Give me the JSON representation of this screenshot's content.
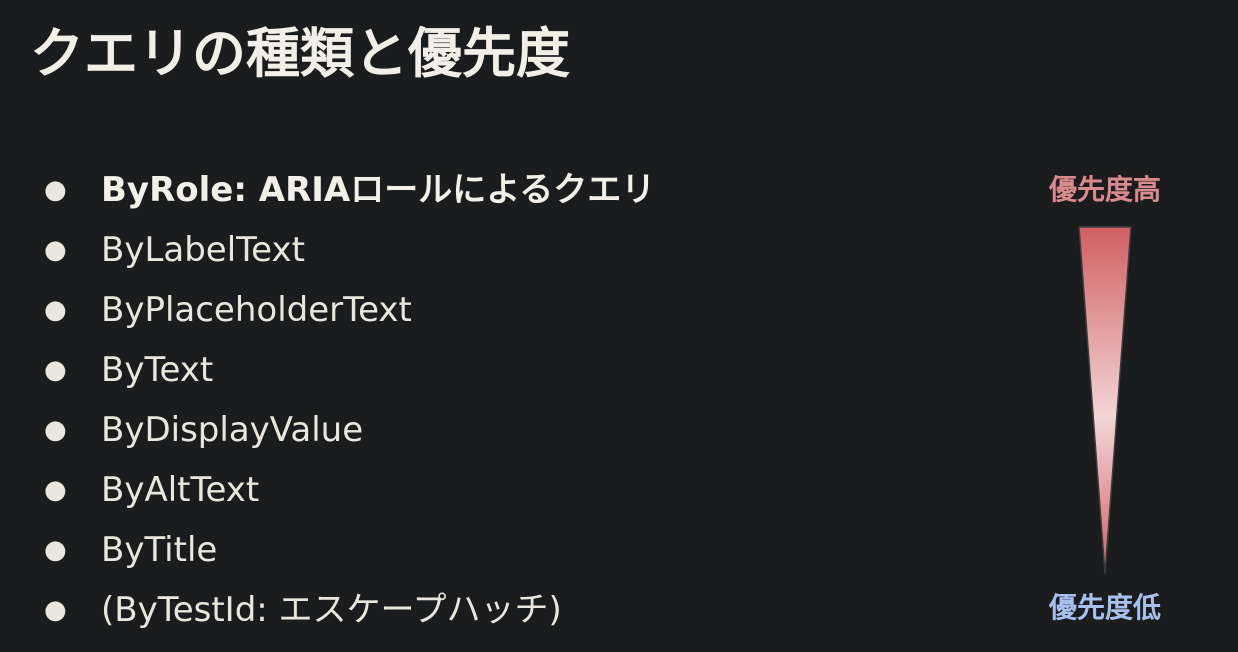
{
  "slide": {
    "title": "クエリの種類と優先度",
    "queries": [
      {
        "bullet": "●",
        "label": "ByRole: ARIAロールによるクエリ",
        "emphasis": true
      },
      {
        "bullet": "●",
        "label": "ByLabelText",
        "emphasis": false
      },
      {
        "bullet": "●",
        "label": "ByPlaceholderText",
        "emphasis": false
      },
      {
        "bullet": "●",
        "label": "ByText",
        "emphasis": false
      },
      {
        "bullet": "●",
        "label": "ByDisplayValue",
        "emphasis": false
      },
      {
        "bullet": "●",
        "label": "ByAltText",
        "emphasis": false
      },
      {
        "bullet": "●",
        "label": "ByTitle",
        "emphasis": false
      },
      {
        "bullet": "●",
        "label": "(ByTestId: エスケープハッチ)",
        "emphasis": false
      }
    ],
    "priority": {
      "high_label": "優先度高",
      "low_label": "優先度低",
      "high_color": "#d98a8c",
      "low_color": "#a6c1ee",
      "wedge_color_top": "#d15f63",
      "wedge_color_mid": "#f3d6d6"
    }
  }
}
